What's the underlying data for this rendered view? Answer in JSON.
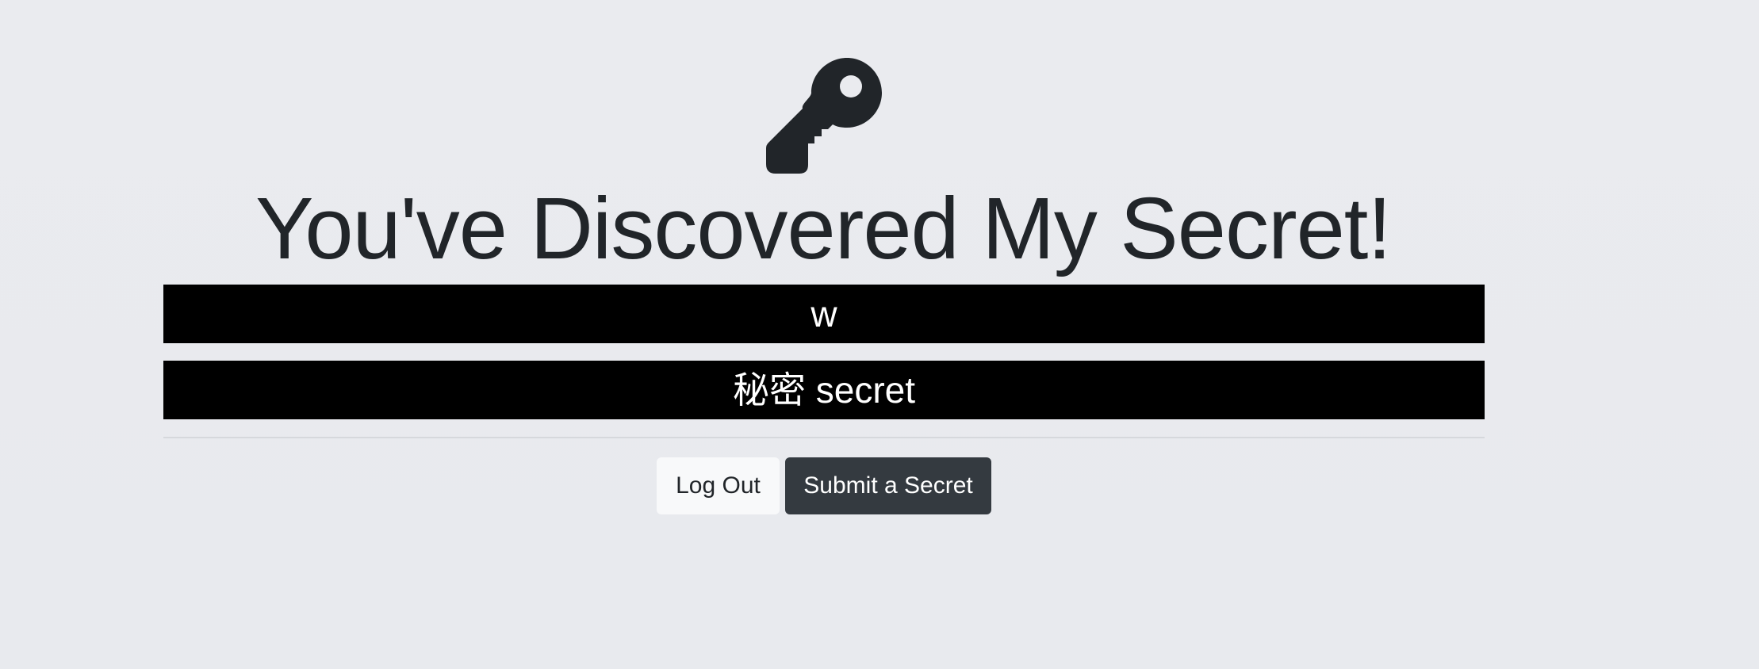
{
  "page": {
    "title": "You've Discovered My Secret!",
    "icon": "key-icon"
  },
  "secrets": [
    {
      "text": "w"
    },
    {
      "text": "秘密 secret"
    }
  ],
  "actions": {
    "logout_label": "Log Out",
    "submit_label": "Submit a Secret"
  },
  "colors": {
    "background": "#eaebef",
    "secret_bar": "#000000",
    "secret_text": "#ffffff",
    "logout_button": "#f8f9fa",
    "submit_button": "#343a40",
    "icon": "#212529"
  }
}
